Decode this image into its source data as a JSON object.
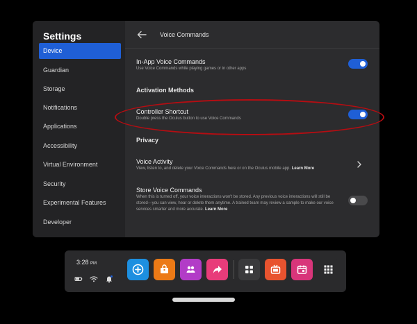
{
  "colors": {
    "accent": "#1f5fd6",
    "panel": "#2c2c2e",
    "sidebar": "#232325",
    "highlight": "#b50d12"
  },
  "sidebar": {
    "title": "Settings",
    "items": [
      {
        "label": "Device",
        "active": true
      },
      {
        "label": "Guardian"
      },
      {
        "label": "Storage"
      },
      {
        "label": "Notifications"
      },
      {
        "label": "Applications"
      },
      {
        "label": "Accessibility"
      },
      {
        "label": "Virtual Environment"
      },
      {
        "label": "Security"
      },
      {
        "label": "Experimental Features"
      },
      {
        "label": "Developer"
      }
    ]
  },
  "main": {
    "title": "Voice Commands",
    "in_app": {
      "title": "In-App Voice Commands",
      "desc": "Use Voice Commands while playing games or in other apps",
      "enabled": true
    },
    "activation_header": "Activation Methods",
    "controller": {
      "title": "Controller Shortcut",
      "desc": "Double press the Oculus button to use Voice Commands",
      "enabled": true
    },
    "privacy_header": "Privacy",
    "voice_activity": {
      "title": "Voice Activity",
      "desc": "View, listen to, and delete your Voice Commands here or on the Oculus mobile app.",
      "link": "Learn More"
    },
    "store": {
      "title": "Store Voice Commands",
      "desc": "When this is turned off, your voice interactions won't be stored. Any previous voice interactions will still be stored—you can view, hear or delete them anytime. A trained team may review a sample to make our voice services smarter and more accurate.",
      "link": "Learn More",
      "enabled": false
    }
  },
  "taskbar": {
    "time": "3:28",
    "ampm": "PM",
    "apps": [
      {
        "icon": "oculus-plus-icon",
        "color": "#1d8fe0"
      },
      {
        "icon": "store-bag-icon",
        "color": "#ec7a16"
      },
      {
        "icon": "people-icon",
        "color": "#b23cc7"
      },
      {
        "icon": "share-icon",
        "color": "#e83c7a"
      },
      {
        "icon": "grid-icon",
        "color": "#3a3a3c"
      },
      {
        "icon": "tv-icon",
        "color": "#e8532f"
      },
      {
        "icon": "calendar-icon",
        "color": "#d8357a"
      },
      {
        "icon": "apps-icon",
        "color": "#2a2a2c"
      }
    ]
  }
}
